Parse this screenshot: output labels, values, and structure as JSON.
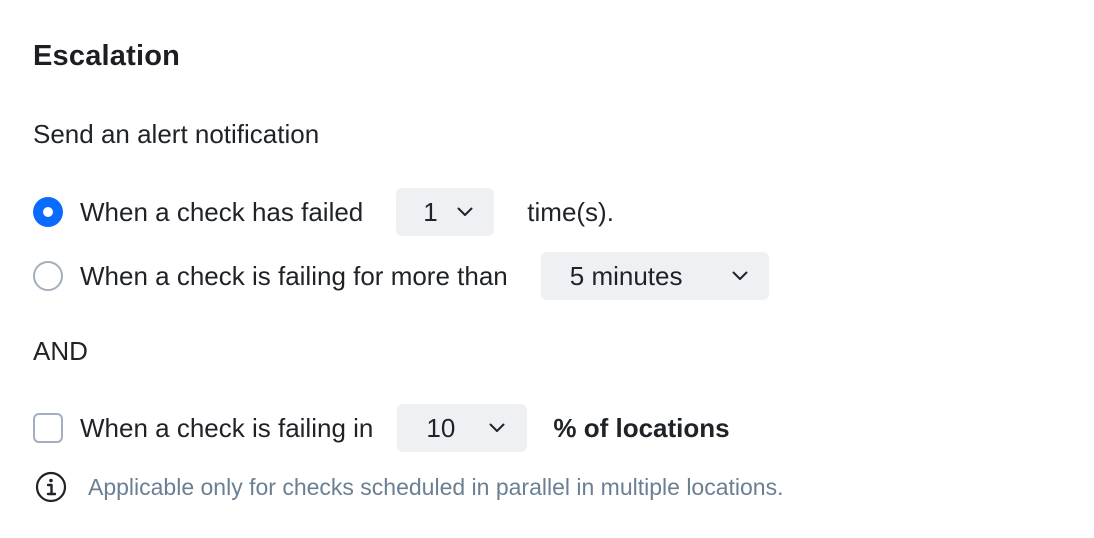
{
  "section": {
    "title": "Escalation",
    "subtitle": "Send an alert notification"
  },
  "options": {
    "failed_times": {
      "label": "When a check has failed",
      "selected": true,
      "select_value": "1",
      "suffix": "time(s)."
    },
    "failing_duration": {
      "label": "When a check is failing for more than",
      "selected": false,
      "select_value": "5 minutes"
    }
  },
  "and_label": "AND",
  "locations": {
    "label": "When a check is failing in",
    "checked": false,
    "select_value": "10",
    "suffix": "% of locations"
  },
  "hint": {
    "icon": "info-icon",
    "text": "Applicable only for checks scheduled in parallel in multiple locations."
  },
  "colors": {
    "accent": "#0a6cff",
    "select_bg": "#eef0f3",
    "hint_text": "#6b7f93",
    "control_border": "#a3afbd"
  }
}
